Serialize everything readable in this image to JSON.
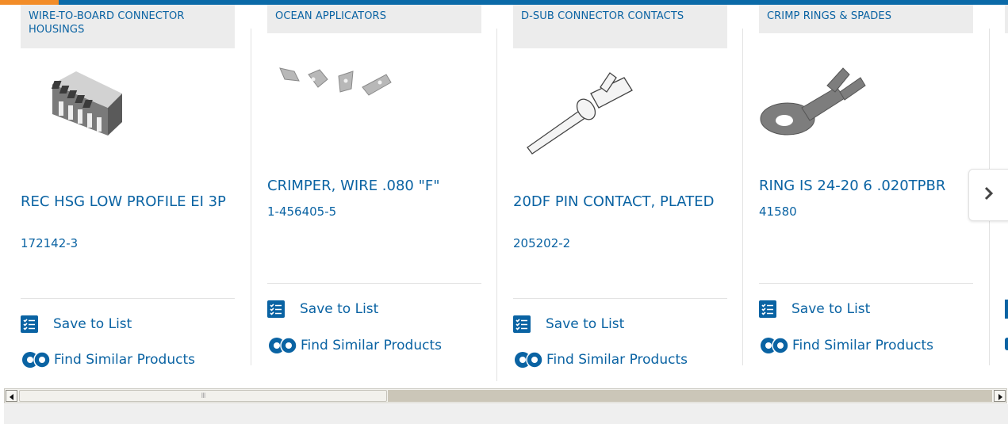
{
  "colors": {
    "brand_blue": "#0a63a3",
    "accent_orange": "#f28c28",
    "category_bg": "#ececec"
  },
  "products": [
    {
      "category": "WIRE-TO-BOARD CONNECTOR HOUSINGS",
      "title": "REC HSG LOW PROFILE EI 3P",
      "part_number": "172142-3",
      "save_label": "Save to List",
      "similar_label": "Find Similar Products",
      "image": "connector-housing-image"
    },
    {
      "category": "OCEAN APPLICATORS",
      "title": "CRIMPER, WIRE .080 \"F\"",
      "part_number": "1-456405-5",
      "save_label": "Save to List",
      "similar_label": "Find Similar Products",
      "image": "crimper-parts-image"
    },
    {
      "category": "D-SUB CONNECTOR CONTACTS",
      "title": "20DF PIN CONTACT, PLATED",
      "part_number": "205202-2",
      "save_label": "Save to List",
      "similar_label": "Find Similar Products",
      "image": "pin-contact-image"
    },
    {
      "category": "CRIMP RINGS & SPADES",
      "title": "RING IS 24-20 6 .020TPBR",
      "part_number": "41580",
      "save_label": "Save to List",
      "similar_label": "Find Similar Products",
      "image": "ring-terminal-image"
    }
  ],
  "carousel": {
    "next_icon": "chevron-right-icon"
  },
  "scrollbar": {
    "left_icon": "arrow-left-icon",
    "right_icon": "arrow-right-icon",
    "grip": "III"
  }
}
